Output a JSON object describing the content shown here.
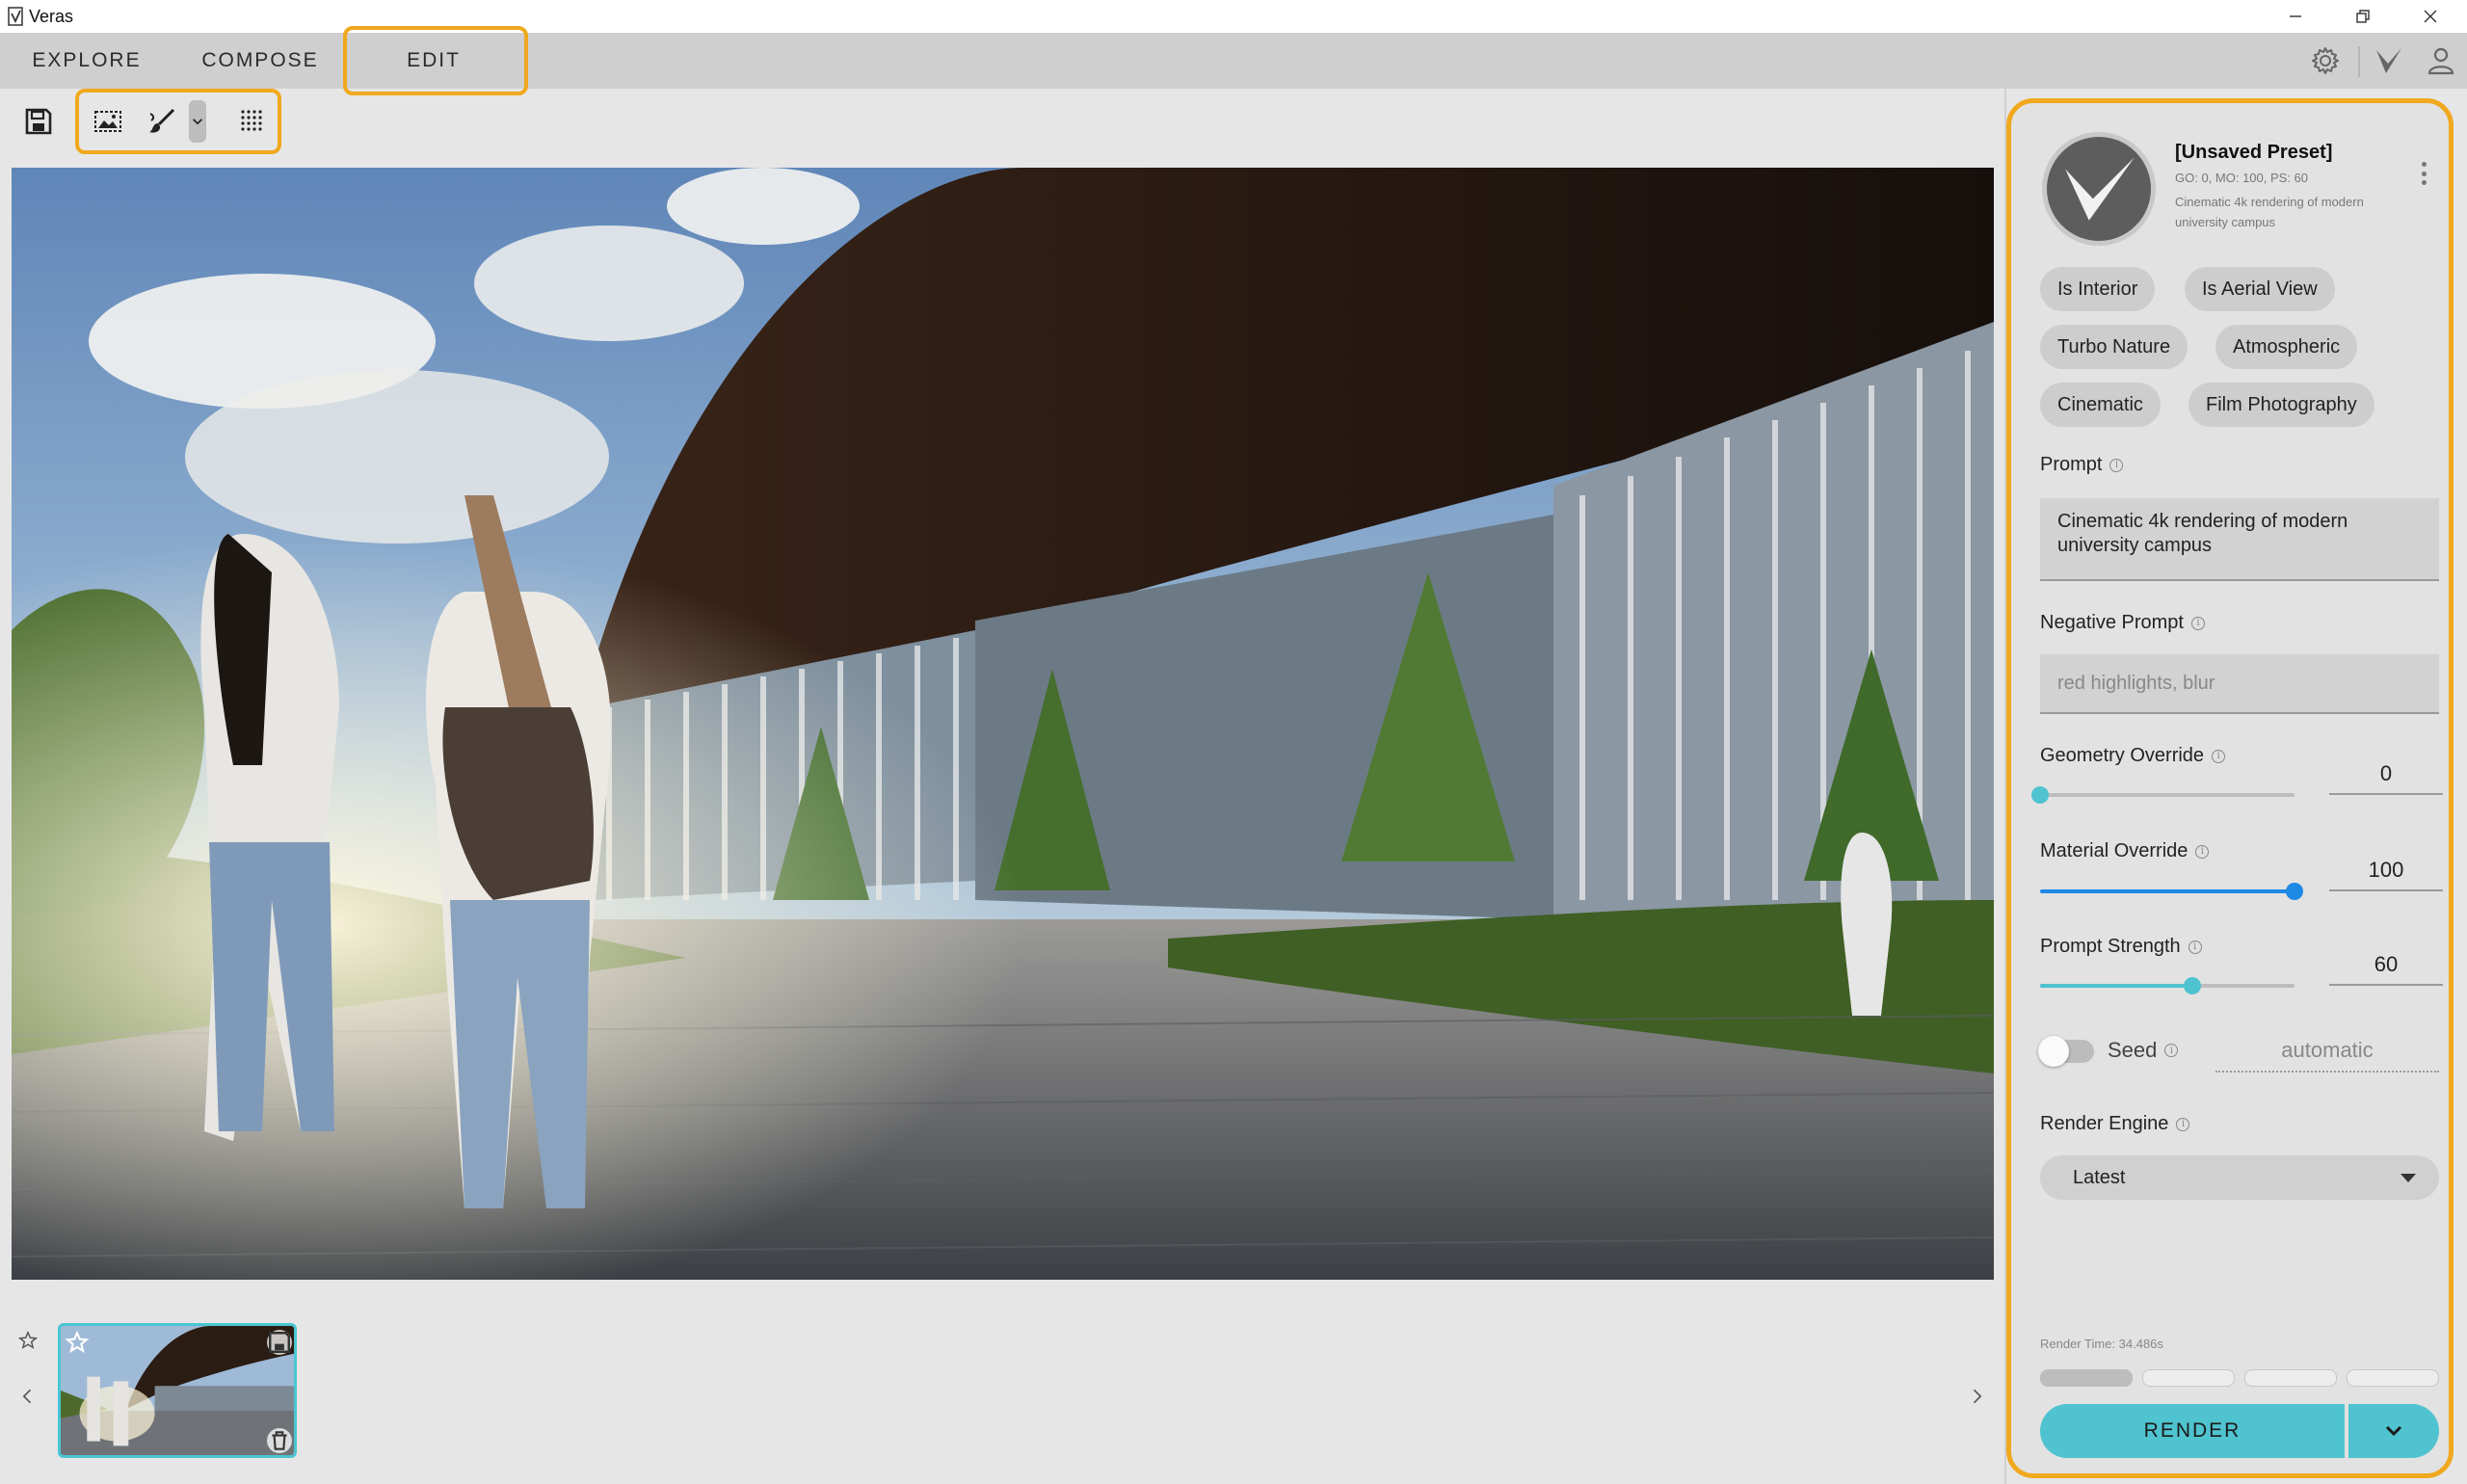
{
  "app": {
    "title": "Veras"
  },
  "tabs": [
    {
      "label": "EXPLORE",
      "active": false
    },
    {
      "label": "COMPOSE",
      "active": false
    },
    {
      "label": "EDIT",
      "active": true
    }
  ],
  "header_icons": [
    "gear-icon",
    "veras-logo-icon",
    "user-icon"
  ],
  "toolbar": {
    "items": [
      "save-icon",
      "image-region-icon",
      "brush-icon",
      "chevron-down-icon",
      "dot-grid-icon"
    ]
  },
  "preset": {
    "title": "[Unsaved Preset]",
    "meta": "GO: 0, MO: 100, PS: 60",
    "description": "Cinematic 4k rendering of modern university campus"
  },
  "chips": [
    "Is Interior",
    "Is Aerial View",
    "Turbo Nature",
    "Atmospheric",
    "Cinematic",
    "Film Photography"
  ],
  "prompt": {
    "label": "Prompt",
    "value": "Cinematic 4k rendering of modern university campus"
  },
  "negative_prompt": {
    "label": "Negative Prompt",
    "placeholder": "red highlights, blur"
  },
  "geometry_override": {
    "label": "Geometry Override",
    "value": "0",
    "level": 0
  },
  "material_override": {
    "label": "Material Override",
    "value": "100",
    "level": 1.0
  },
  "prompt_strength": {
    "label": "Prompt Strength",
    "value": "60",
    "level": 0.6
  },
  "seed": {
    "label": "Seed",
    "value": "automatic",
    "enabled": false
  },
  "render_engine": {
    "label": "Render Engine",
    "selected": "Latest"
  },
  "render_time": "Render Time: 34.486s",
  "render_button": "RENDER",
  "colors": {
    "accent": "#4fc3cf",
    "slider_blue": "#1e88e5",
    "slider_teal": "#4fc3cf",
    "highlight": "#f0a81e"
  }
}
